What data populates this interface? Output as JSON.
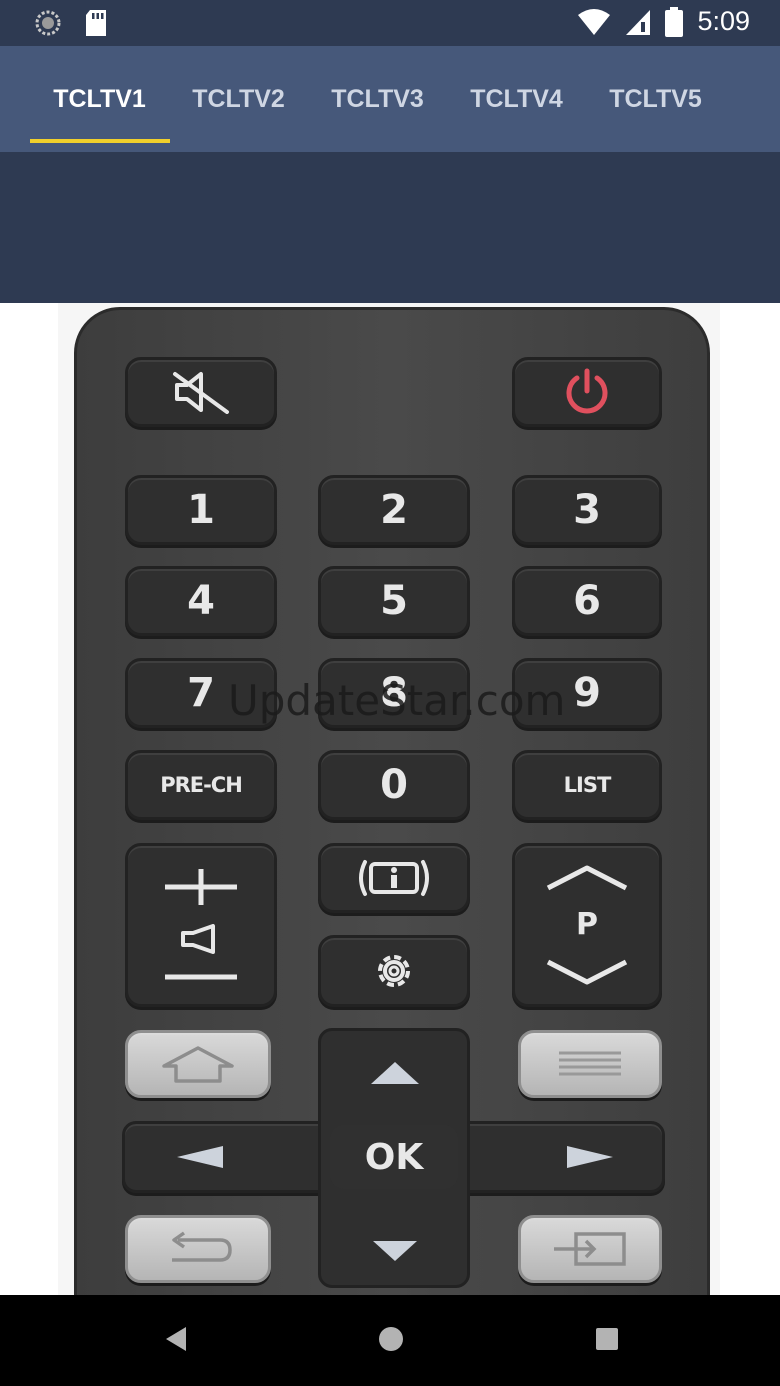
{
  "status_bar": {
    "time": "5:09",
    "left_icons": [
      "loading-icon",
      "sd-card-icon"
    ],
    "right_icons": [
      "wifi-icon",
      "signal-icon",
      "battery-icon"
    ]
  },
  "tabs": [
    {
      "label": "TCLTV1",
      "active": true
    },
    {
      "label": "TCLTV2",
      "active": false
    },
    {
      "label": "TCLTV3",
      "active": false
    },
    {
      "label": "TCLTV4",
      "active": false
    },
    {
      "label": "TCLTV5",
      "active": false
    }
  ],
  "colors": {
    "status_bar": "#2e3a52",
    "tab_bar": "#46587a",
    "tab_indicator": "#f1d02c",
    "power_icon": "#e0505e"
  },
  "remote": {
    "digits": [
      "1",
      "2",
      "3",
      "4",
      "5",
      "6",
      "7",
      "8",
      "9",
      "0"
    ],
    "pre_ch_label": "PRE-CH",
    "list_label": "LIST",
    "program_label": "P",
    "ok_label": "OK",
    "icons": [
      "mute-icon",
      "power-icon",
      "volume-icon",
      "info-icon",
      "settings-icon",
      "home-icon",
      "menu-icon",
      "back-icon",
      "input-source-icon",
      "arrow-up-icon",
      "arrow-down-icon",
      "arrow-left-icon",
      "arrow-right-icon"
    ]
  },
  "watermark": "UpdateStar.com",
  "nav_bar": {
    "icons": [
      "back-nav-icon",
      "home-nav-icon",
      "recents-nav-icon"
    ]
  }
}
